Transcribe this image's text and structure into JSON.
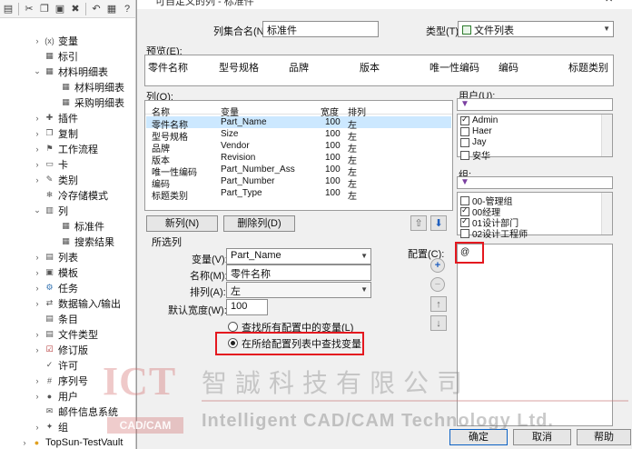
{
  "tree": {
    "items": [
      {
        "label": "变量",
        "arrow": ">",
        "icon": "x-variable-icon",
        "indent": 1
      },
      {
        "label": "标引",
        "arrow": "",
        "icon": "index-icon",
        "indent": 1
      },
      {
        "label": "材料明细表",
        "arrow": "v",
        "icon": "bom-icon",
        "indent": 1
      },
      {
        "label": "材料明细表",
        "arrow": "",
        "icon": "table-icon",
        "indent": 2
      },
      {
        "label": "采购明细表",
        "arrow": "",
        "icon": "table-icon",
        "indent": 2
      },
      {
        "label": "插件",
        "arrow": ">",
        "icon": "plugin-icon",
        "indent": 1
      },
      {
        "label": "复制",
        "arrow": ">",
        "icon": "copy-icon",
        "indent": 1
      },
      {
        "label": "工作流程",
        "arrow": ">",
        "icon": "workflow-icon",
        "indent": 1
      },
      {
        "label": "卡",
        "arrow": ">",
        "icon": "card-icon",
        "indent": 1
      },
      {
        "label": "类别",
        "arrow": ">",
        "icon": "category-icon",
        "indent": 1
      },
      {
        "label": "冷存储模式",
        "arrow": "",
        "icon": "cold-storage-icon",
        "indent": 1
      },
      {
        "label": "列",
        "arrow": "v",
        "icon": "columns-icon",
        "indent": 1
      },
      {
        "label": "标准件",
        "arrow": "",
        "icon": "table-icon",
        "indent": 2
      },
      {
        "label": "搜索结果",
        "arrow": "",
        "icon": "table-icon",
        "indent": 2
      },
      {
        "label": "列表",
        "arrow": ">",
        "icon": "list-icon",
        "indent": 1
      },
      {
        "label": "模板",
        "arrow": ">",
        "icon": "template-icon",
        "indent": 1
      },
      {
        "label": "任务",
        "arrow": ">",
        "icon": "task-icon",
        "indent": 1
      },
      {
        "label": "数据输入/输出",
        "arrow": ">",
        "icon": "import-export-icon",
        "indent": 1
      },
      {
        "label": "条目",
        "arrow": "",
        "icon": "entry-icon",
        "indent": 1
      },
      {
        "label": "文件类型",
        "arrow": ">",
        "icon": "file-type-icon",
        "indent": 1
      },
      {
        "label": "修订版",
        "arrow": ">",
        "icon": "revision-icon",
        "indent": 1
      },
      {
        "label": "许可",
        "arrow": "",
        "icon": "license-icon",
        "indent": 1
      },
      {
        "label": "序列号",
        "arrow": ">",
        "icon": "serial-number-icon",
        "indent": 1
      },
      {
        "label": "用户",
        "arrow": ">",
        "icon": "user-icon",
        "indent": 1
      },
      {
        "label": "邮件信息系统",
        "arrow": "",
        "icon": "mail-icon",
        "indent": 1
      },
      {
        "label": "组",
        "arrow": ">",
        "icon": "group-icon",
        "indent": 1
      },
      {
        "label": "TopSun-TestVault",
        "arrow": ">",
        "icon": "vault-icon",
        "indent": 0
      }
    ]
  },
  "dialog": {
    "title": "可自定义的列 - 标准件",
    "set_name_label": "列集合名(N):",
    "set_name_value": "标准件",
    "type_label": "类型(T):",
    "type_value": "文件列表",
    "preview_label": "预览(E):",
    "preview_columns": [
      "零件名称",
      "型号规格",
      "品牌",
      "版本",
      "唯一性编码",
      "编码",
      "标题类别"
    ],
    "columns_label": "列(O):",
    "columns_headers": [
      "名称",
      "变量",
      "宽度",
      "排列"
    ],
    "columns_rows": [
      {
        "name": "零件名称",
        "variable": "Part_Name",
        "width": "100",
        "align": "左"
      },
      {
        "name": "型号规格",
        "variable": "Size",
        "width": "100",
        "align": "左"
      },
      {
        "name": "品牌",
        "variable": "Vendor",
        "width": "100",
        "align": "左"
      },
      {
        "name": "版本",
        "variable": "Revision",
        "width": "100",
        "align": "左"
      },
      {
        "name": "唯一性编码",
        "variable": "Part_Number_Ass",
        "width": "100",
        "align": "左"
      },
      {
        "name": "编码",
        "variable": "Part_Number",
        "width": "100",
        "align": "左"
      },
      {
        "name": "标题类别",
        "variable": "Part_Type",
        "width": "100",
        "align": "左"
      }
    ],
    "new_column_button": "新列(N)",
    "delete_column_button": "删除列(D)",
    "selected_column_label": "所选列",
    "variable_label": "变量(V):",
    "variable_value": "Part_Name",
    "name_label": "名称(M):",
    "name_value": "零件名称",
    "align_label": "排列(A):",
    "align_value": "左",
    "default_width_label": "默认宽度(W):",
    "default_width_value": "100",
    "radio_all_configs": "查找所有配置中的变量(L)",
    "radio_given_config": "在所给配置列表中查找变量",
    "users_label": "用户(U):",
    "users": [
      {
        "label": "Admin",
        "checked": true
      },
      {
        "label": "Haer",
        "checked": false
      },
      {
        "label": "Jay",
        "checked": false
      },
      {
        "label": "安华",
        "checked": false
      }
    ],
    "groups_label": "组:",
    "groups": [
      {
        "label": "00-管理组",
        "checked": false
      },
      {
        "label": "00经理",
        "checked": true
      },
      {
        "label": "01设计部门",
        "checked": true
      },
      {
        "label": "02设计工程师",
        "checked": false
      }
    ],
    "config_label": "配置(C):",
    "config_value": "@",
    "ok_button": "确定",
    "cancel_button": "取消",
    "help_button": "帮助"
  },
  "watermark": {
    "ict": "ICT",
    "cad_cam": "CAD/CAM",
    "company_cn": "智誠科技有限公司",
    "company_en": "Intelligent CAD/CAM Technology Ltd."
  },
  "colors": {
    "highlight": "#e4181f",
    "selection": "#cce8ff"
  }
}
